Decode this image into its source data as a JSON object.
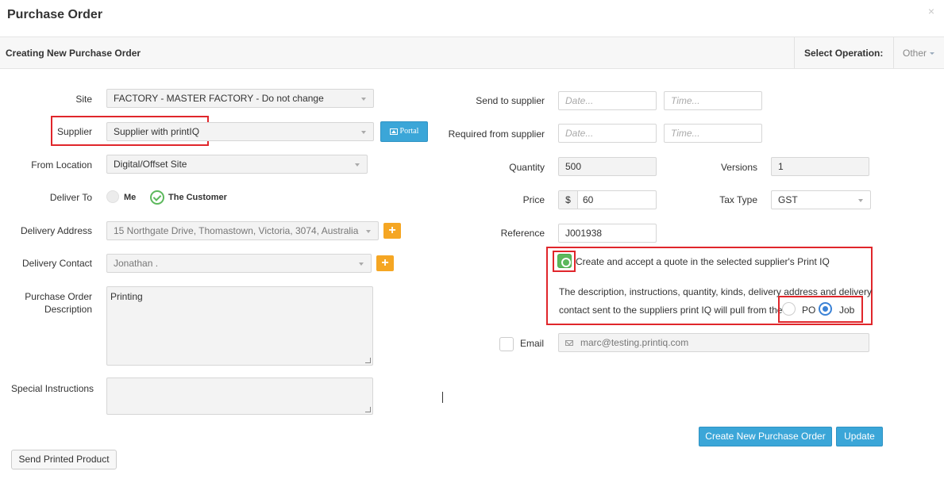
{
  "header": {
    "title": "Purchase Order",
    "close": "×",
    "subtitle": "Creating New Purchase Order",
    "select_operation": "Select Operation:",
    "other": "Other"
  },
  "left": {
    "site": {
      "label": "Site",
      "value": "FACTORY - MASTER FACTORY - Do not change"
    },
    "supplier": {
      "label": "Supplier",
      "value": "Supplier with printIQ",
      "portal_label": "Portal"
    },
    "from_location": {
      "label": "From Location",
      "value": "Digital/Offset Site"
    },
    "deliver_to": {
      "label": "Deliver To",
      "opt_me": "Me",
      "opt_customer": "The Customer"
    },
    "delivery_address": {
      "label": "Delivery Address",
      "value": "15 Northgate Drive, Thomastown, Victoria, 3074, Australia"
    },
    "delivery_contact": {
      "label": "Delivery Contact",
      "value": "Jonathan ."
    },
    "po_description": {
      "label_line1": "Purchase Order",
      "label_line2": "Description",
      "value": "Printing"
    },
    "special_instructions": {
      "label": "Special Instructions",
      "value": ""
    },
    "send_printed_product": "Send Printed Product"
  },
  "right": {
    "send_to_supplier": {
      "label": "Send to supplier",
      "date_ph": "Date...",
      "time_ph": "Time..."
    },
    "required_from_supplier": {
      "label": "Required from supplier",
      "date_ph": "Date...",
      "time_ph": "Time..."
    },
    "quantity": {
      "label": "Quantity",
      "value": "500"
    },
    "versions": {
      "label": "Versions",
      "value": "1"
    },
    "price": {
      "label": "Price",
      "currency": "$",
      "value": "60"
    },
    "tax_type": {
      "label": "Tax Type",
      "value": "GST"
    },
    "reference": {
      "label": "Reference",
      "value": "J001938"
    },
    "quote": {
      "checkbox_label": "Create and accept a quote in the selected supplier's Print IQ",
      "desc_line1": "The description, instructions, quantity, kinds, delivery address and delivery",
      "desc_line2": "contact sent to the suppliers print IQ will pull from the",
      "opt_po": "PO",
      "opt_job": "Job"
    },
    "email": {
      "label": "Email",
      "value": "marc@testing.printiq.com"
    }
  },
  "footer": {
    "create_button": "Create New Purchase Order",
    "update_button": "Update"
  },
  "colors": {
    "accent": "#3ba6d8",
    "highlight": "#e0262b",
    "plus": "#f5a623",
    "success": "#5cb85c"
  }
}
